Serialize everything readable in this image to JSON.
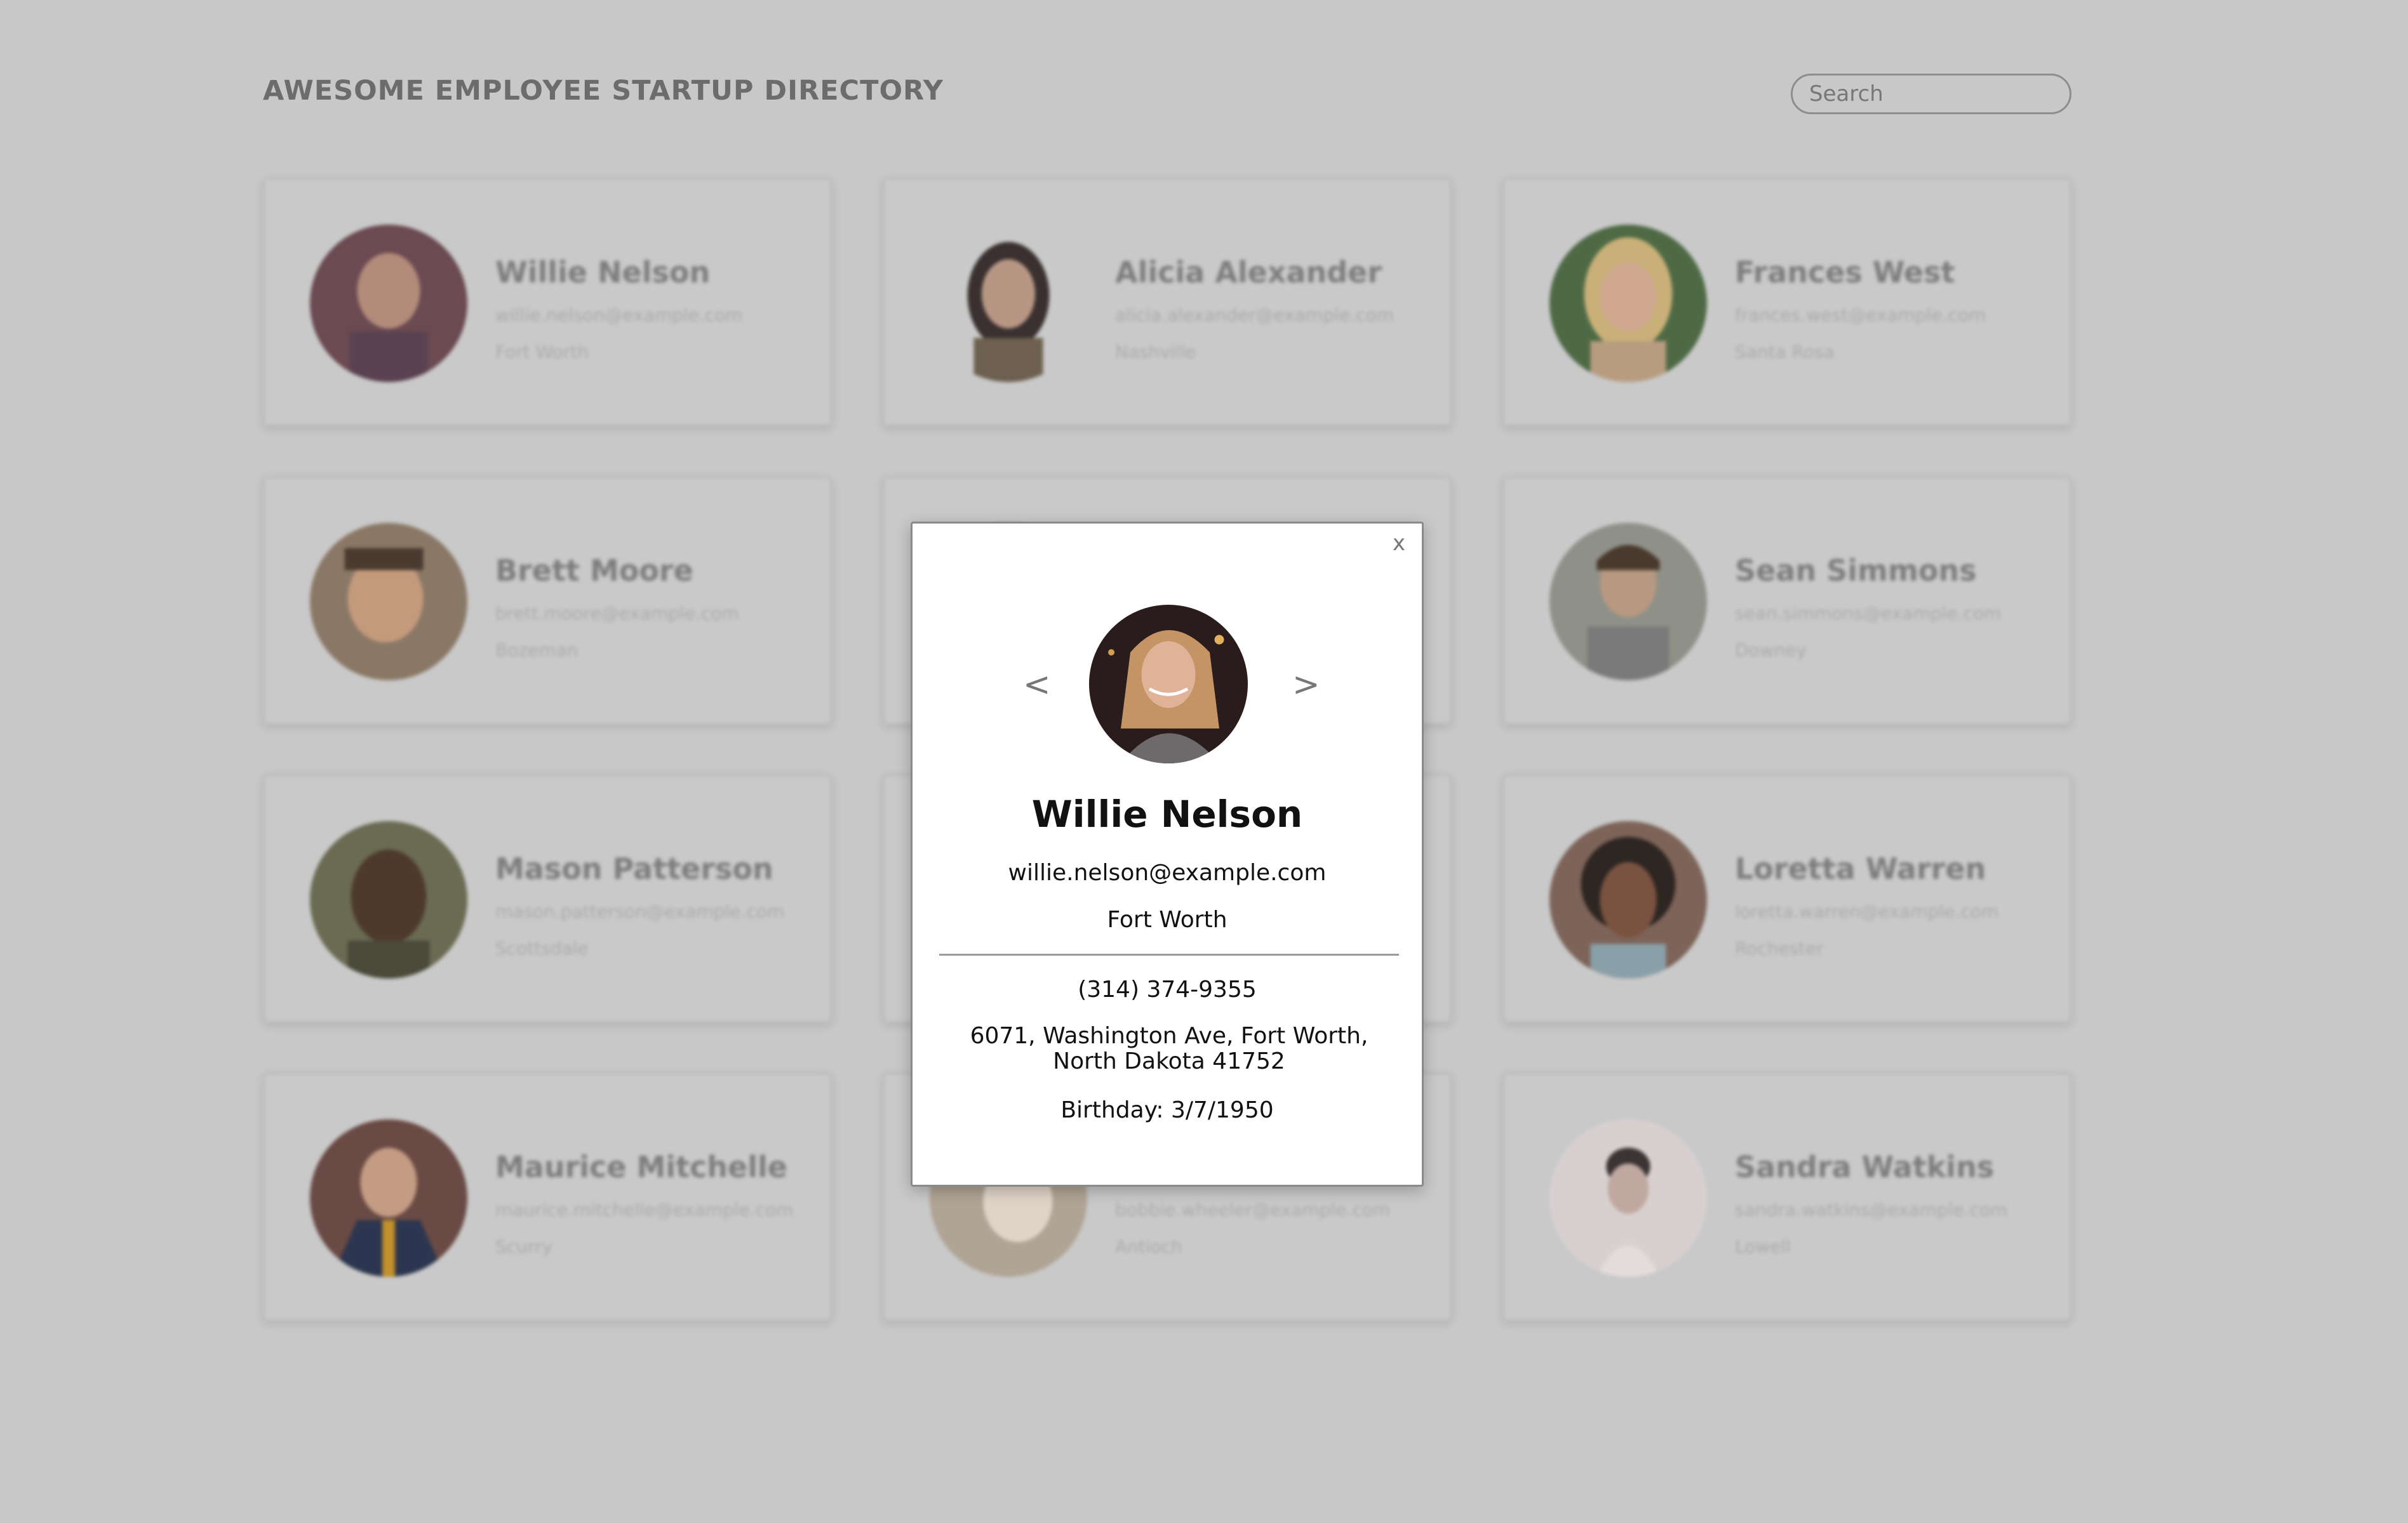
{
  "header": {
    "title": "AWESOME EMPLOYEE STARTUP DIRECTORY",
    "search_placeholder": "Search"
  },
  "employees": [
    {
      "name": "Willie Nelson",
      "email": "willie.nelson@example.com",
      "city": "Fort Worth"
    },
    {
      "name": "Alicia Alexander",
      "email": "alicia.alexander@example.com",
      "city": "Nashville"
    },
    {
      "name": "Frances West",
      "email": "frances.west@example.com",
      "city": "Santa Rosa"
    },
    {
      "name": "Brett Moore",
      "email": "brett.moore@example.com",
      "city": "Bozeman"
    },
    {
      "name": "",
      "email": "",
      "city": ""
    },
    {
      "name": "Sean Simmons",
      "email": "sean.simmons@example.com",
      "city": "Downey"
    },
    {
      "name": "Mason Patterson",
      "email": "mason.patterson@example.com",
      "city": "Scottsdale"
    },
    {
      "name": "",
      "email": "",
      "city": ""
    },
    {
      "name": "Loretta Warren",
      "email": "loretta.warren@example.com",
      "city": "Rochester"
    },
    {
      "name": "Maurice Mitchelle",
      "email": "maurice.mitchelle@example.com",
      "city": "Scurry"
    },
    {
      "name": "",
      "email": "bobbie.wheeler@example.com",
      "city": "Antioch"
    },
    {
      "name": "Sandra Watkins",
      "email": "sandra.watkins@example.com",
      "city": "Lowell"
    }
  ],
  "modal": {
    "close_label": "x",
    "prev_label": "<",
    "next_label": ">",
    "name": "Willie Nelson",
    "email": "willie.nelson@example.com",
    "city": "Fort Worth",
    "phone": "(314) 374-9355",
    "address": "6071, Washington Ave, Fort Worth, North Dakota 41752",
    "birthday": "Birthday: 3/7/1950"
  },
  "colors": {
    "overlay_bg": "#c8c8c8",
    "title_text": "#6c6c6c",
    "modal_bg": "#ffffff"
  }
}
